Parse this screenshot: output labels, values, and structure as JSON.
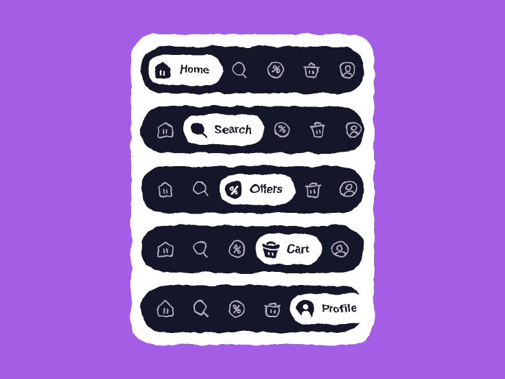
{
  "theme": {
    "background_color": "#a45ee5",
    "card_color": "#ffffff",
    "bar_color": "#191429",
    "inactive_icon_color": "#b4aec2",
    "active_pill_color": "#ffffff",
    "active_text_color": "#191429"
  },
  "nav_items": [
    {
      "id": "home",
      "label": "Home",
      "icon": "home-icon"
    },
    {
      "id": "search",
      "label": "Search",
      "icon": "search-icon"
    },
    {
      "id": "offers",
      "label": "Offers",
      "icon": "percent-badge-icon"
    },
    {
      "id": "cart",
      "label": "Cart",
      "icon": "shopping-basket-icon"
    },
    {
      "id": "profile",
      "label": "Profile",
      "icon": "user-circle-icon"
    }
  ],
  "bars": [
    {
      "id": "navbar-home",
      "active": "home",
      "active_label": "Home"
    },
    {
      "id": "navbar-search",
      "active": "search",
      "active_label": "Search"
    },
    {
      "id": "navbar-offers",
      "active": "offers",
      "active_label": "Offers"
    },
    {
      "id": "navbar-cart",
      "active": "cart",
      "active_label": "Cart"
    },
    {
      "id": "navbar-profile",
      "active": "profile",
      "active_label": "Profile"
    }
  ]
}
